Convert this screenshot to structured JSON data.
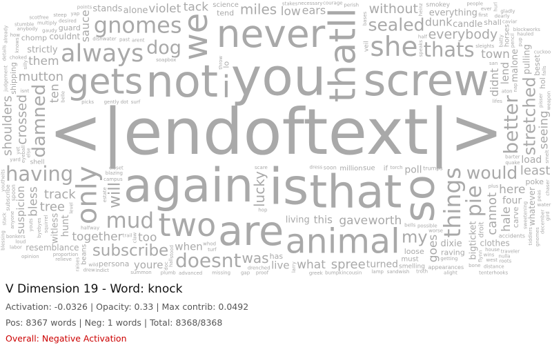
{
  "title": "V Dimension 19 - Word: knock",
  "stats_line": "Activation: -0.0326 | Opacity: 0.33 | Max contrib: 0.0492",
  "counts_line": "Pos: 8367 words | Neg: 1 words | Total: 8368/8368",
  "status": {
    "text": "Overall: Negative Activation",
    "color": "#cc0000"
  },
  "word_cloud": {
    "text_color": "#a9a9a9",
    "words": [
      {
        "text": "<|endoftext|>",
        "weight": 100
      },
      {
        "text": "you",
        "weight": 82
      },
      {
        "text": "is",
        "weight": 78
      },
      {
        "text": "again",
        "weight": 74
      },
      {
        "text": "that",
        "weight": 72
      },
      {
        "text": "not",
        "weight": 70
      },
      {
        "text": "screw",
        "weight": 68
      },
      {
        "text": "so",
        "weight": 66
      },
      {
        "text": "are",
        "weight": 64
      },
      {
        "text": "never",
        "weight": 60
      },
      {
        "text": "thatll",
        "weight": 58
      },
      {
        "text": "gets",
        "weight": 55
      },
      {
        "text": "animal",
        "weight": 53
      },
      {
        "text": "we",
        "weight": 52
      },
      {
        "text": "two",
        "weight": 50
      },
      {
        "text": "i",
        "weight": 48
      },
      {
        "text": "only",
        "weight": 44
      },
      {
        "text": "she",
        "weight": 42
      },
      {
        "text": "always",
        "weight": 38
      },
      {
        "text": "things",
        "weight": 36
      },
      {
        "text": "gnomes",
        "weight": 35
      },
      {
        "text": "mud",
        "weight": 34
      },
      {
        "text": "pie",
        "weight": 33
      },
      {
        "text": "thats",
        "weight": 32
      },
      {
        "text": "having",
        "weight": 31
      },
      {
        "text": "better",
        "weight": 30
      },
      {
        "text": "doesnt",
        "weight": 30
      },
      {
        "text": "dog",
        "weight": 29
      },
      {
        "text": "damned",
        "weight": 28
      },
      {
        "text": "would",
        "weight": 27
      },
      {
        "text": "sealed",
        "weight": 27
      },
      {
        "text": "stretched",
        "weight": 26
      },
      {
        "text": "my",
        "weight": 26
      },
      {
        "text": "subscribe",
        "weight": 25
      },
      {
        "text": "will",
        "weight": 25
      },
      {
        "text": "was",
        "weight": 22
      },
      {
        "text": "miles",
        "weight": 22
      },
      {
        "text": "lucky",
        "weight": 22
      },
      {
        "text": "everybody",
        "weight": 21
      },
      {
        "text": "without",
        "weight": 21
      },
      {
        "text": "crossed",
        "weight": 21
      },
      {
        "text": "track",
        "weight": 20
      },
      {
        "text": "mutton",
        "weight": 20
      },
      {
        "text": "shoulders",
        "weight": 20
      },
      {
        "text": "spree",
        "weight": 20
      },
      {
        "text": "tree",
        "weight": 20
      },
      {
        "text": "cannot",
        "weight": 20
      },
      {
        "text": "least",
        "weight": 20
      },
      {
        "text": "worth",
        "weight": 19
      },
      {
        "text": "goes",
        "weight": 19
      },
      {
        "text": "violet",
        "weight": 19
      },
      {
        "text": "low",
        "weight": 19
      },
      {
        "text": "seeing",
        "weight": 19
      },
      {
        "text": "together",
        "weight": 19
      },
      {
        "text": "too",
        "weight": 19
      },
      {
        "text": "ten",
        "weight": 18
      },
      {
        "text": "gave",
        "weight": 18
      },
      {
        "text": "what",
        "weight": 18
      },
      {
        "text": "hale",
        "weight": 18
      },
      {
        "text": "tack",
        "weight": 18
      },
      {
        "text": "here",
        "weight": 18
      },
      {
        "text": "bless",
        "weight": 18
      },
      {
        "text": "town",
        "weight": 18
      },
      {
        "text": "them",
        "weight": 18
      },
      {
        "text": "sauce",
        "weight": 17
      },
      {
        "text": "dunk",
        "weight": 17
      },
      {
        "text": "ears",
        "weight": 17
      },
      {
        "text": "didnt",
        "weight": 17
      },
      {
        "text": "this",
        "weight": 16
      },
      {
        "text": "when",
        "weight": 16
      },
      {
        "text": "suspicion",
        "weight": 16
      },
      {
        "text": "youre",
        "weight": 16
      },
      {
        "text": "live",
        "weight": 16
      },
      {
        "text": "lend",
        "weight": 16
      },
      {
        "text": "load",
        "weight": 15
      },
      {
        "text": "four",
        "weight": 15
      },
      {
        "text": "hunt",
        "weight": 15
      },
      {
        "text": "poll",
        "weight": 15
      },
      {
        "text": "turned",
        "weight": 15
      },
      {
        "text": "malone",
        "weight": 14
      },
      {
        "text": "strictly",
        "weight": 14
      },
      {
        "text": "everything",
        "weight": 14
      },
      {
        "text": "bigticket",
        "weight": 14
      },
      {
        "text": "living",
        "weight": 14
      },
      {
        "text": "dixie",
        "weight": 14
      },
      {
        "text": "witless",
        "weight": 14
      },
      {
        "text": "alone",
        "weight": 14
      },
      {
        "text": "candle",
        "weight": 14
      },
      {
        "text": "pulling",
        "weight": 14
      },
      {
        "text": "stands",
        "weight": 14
      },
      {
        "text": "clothes",
        "weight": 13
      },
      {
        "text": "whatever",
        "weight": 13
      },
      {
        "text": "resemblance",
        "weight": 13
      },
      {
        "text": "couldnt",
        "weight": 13
      },
      {
        "text": "shipping",
        "weight": 12
      },
      {
        "text": "persona",
        "weight": 12
      },
      {
        "text": "loose",
        "weight": 12
      },
      {
        "text": "beset",
        "weight": 12
      },
      {
        "text": "raving",
        "weight": 12
      },
      {
        "text": "chomp",
        "weight": 12
      },
      {
        "text": "carve",
        "weight": 12
      },
      {
        "text": "tend",
        "weight": 12
      },
      {
        "text": "poke",
        "weight": 12
      },
      {
        "text": "lo",
        "weight": 12
      },
      {
        "text": "has",
        "weight": 12
      },
      {
        "text": "guard",
        "weight": 12
      },
      {
        "text": "hol",
        "weight": 12
      },
      {
        "text": "shall",
        "weight": 12
      },
      {
        "text": "must",
        "weight": 11
      },
      {
        "text": "droit",
        "weight": 11
      },
      {
        "text": "sue",
        "weight": 11
      },
      {
        "text": "if",
        "weight": 11
      },
      {
        "text": "beans",
        "weight": 11
      },
      {
        "text": "science",
        "weight": 11
      },
      {
        "text": "million",
        "weight": 11
      },
      {
        "text": "horses",
        "weight": 11
      },
      {
        "text": "smokey",
        "weight": 10
      },
      {
        "text": "shell",
        "weight": 10
      },
      {
        "text": "veil",
        "weight": 10
      },
      {
        "text": "smelling",
        "weight": 10
      },
      {
        "text": "appearances",
        "weight": 9
      },
      {
        "text": "spoon",
        "weight": 9
      },
      {
        "text": "trumps",
        "weight": 9
      },
      {
        "text": "soon",
        "weight": 9
      },
      {
        "text": "subscribe",
        "weight": 9
      },
      {
        "text": "accidents",
        "weight": 9
      },
      {
        "text": "campus",
        "weight": 8
      },
      {
        "text": "estate",
        "weight": 8
      },
      {
        "text": "drenched",
        "weight": 8
      },
      {
        "text": "blazing",
        "weight": 8
      },
      {
        "text": "belle",
        "weight": 8
      },
      {
        "text": "closet",
        "weight": 8
      },
      {
        "text": "soapbox",
        "weight": 8
      },
      {
        "text": "eyeball",
        "weight": 8
      },
      {
        "text": "dress",
        "weight": 8
      },
      {
        "text": "surf",
        "weight": 8
      },
      {
        "text": "bases",
        "weight": 8
      },
      {
        "text": "bells",
        "weight": 8
      },
      {
        "text": "possible",
        "weight": 8
      },
      {
        "text": "judgement",
        "weight": 8
      },
      {
        "text": "halfway",
        "weight": 8
      },
      {
        "text": "bumpkincousin",
        "weight": 8
      },
      {
        "text": "sweetening",
        "weight": 8
      },
      {
        "text": "barter",
        "weight": 8
      },
      {
        "text": "stakes",
        "weight": 8
      },
      {
        "text": "throw",
        "weight": 8
      },
      {
        "text": "scare",
        "weight": 8
      },
      {
        "text": "plumb",
        "weight": 8
      },
      {
        "text": "claw",
        "weight": 8
      },
      {
        "text": "getting",
        "weight": 8
      },
      {
        "text": "quake",
        "weight": 8
      },
      {
        "text": "larry",
        "weight": 8
      },
      {
        "text": "torch",
        "weight": 8
      },
      {
        "text": "picks",
        "weight": 8
      },
      {
        "text": "pisser",
        "weight": 8
      },
      {
        "text": "missing",
        "weight": 8
      },
      {
        "text": "necessary",
        "weight": 8
      },
      {
        "text": "december",
        "weight": 8
      },
      {
        "text": "desired",
        "weight": 8
      },
      {
        "text": "multiply",
        "weight": 8
      },
      {
        "text": "weapon",
        "weight": 8
      },
      {
        "text": "choked",
        "weight": 8
      },
      {
        "text": "lifes",
        "weight": 8
      },
      {
        "text": "smelt",
        "weight": 8
      },
      {
        "text": "arent",
        "weight": 8
      },
      {
        "text": "past",
        "weight": 8
      },
      {
        "text": "speaks",
        "weight": 8
      },
      {
        "text": "dishwater",
        "weight": 8
      },
      {
        "text": "proportion",
        "weight": 8
      },
      {
        "text": "stood",
        "weight": 8
      },
      {
        "text": "courage",
        "weight": 8
      },
      {
        "text": "half",
        "weight": 8
      },
      {
        "text": "else",
        "weight": 8
      },
      {
        "text": "plus",
        "weight": 8
      },
      {
        "text": "proof",
        "weight": 8
      },
      {
        "text": "squirrel",
        "weight": 8
      },
      {
        "text": "whod",
        "weight": 8
      },
      {
        "text": "yard",
        "weight": 8
      },
      {
        "text": "knows",
        "weight": 8
      },
      {
        "text": "sleights",
        "weight": 8
      },
      {
        "text": "perish",
        "weight": 8
      },
      {
        "text": "byebyes",
        "weight": 8
      },
      {
        "text": "hop",
        "weight": 8
      },
      {
        "text": "gap",
        "weight": 8
      },
      {
        "text": "heinz",
        "weight": 8
      },
      {
        "text": "gently",
        "weight": 8
      },
      {
        "text": "first",
        "weight": 8
      },
      {
        "text": "falls",
        "weight": 8
      },
      {
        "text": "worse",
        "weight": 8
      },
      {
        "text": "gaudy",
        "weight": 8
      },
      {
        "text": "flynn",
        "weight": 8
      },
      {
        "text": "indict",
        "weight": 8
      },
      {
        "text": "greek",
        "weight": 8
      },
      {
        "text": "batty",
        "weight": 8
      },
      {
        "text": "wild",
        "weight": 8
      },
      {
        "text": "trail",
        "weight": 8
      },
      {
        "text": "level",
        "weight": 8
      },
      {
        "text": "anybody",
        "weight": 8
      },
      {
        "text": "isnt",
        "weight": 8
      },
      {
        "text": "chaser",
        "weight": 8
      },
      {
        "text": "dearly",
        "weight": 8
      },
      {
        "text": "bonkers",
        "weight": 8
      },
      {
        "text": "anyone",
        "weight": 8
      },
      {
        "text": "bone",
        "weight": 8
      },
      {
        "text": "caviar",
        "weight": 8
      },
      {
        "text": "peas",
        "weight": 8
      },
      {
        "text": "aton",
        "weight": 8
      },
      {
        "text": "summon",
        "weight": 8
      },
      {
        "text": "pup",
        "weight": 8
      },
      {
        "text": "yap",
        "weight": 8
      },
      {
        "text": "troth",
        "weight": 8
      },
      {
        "text": "nap",
        "weight": 8
      },
      {
        "text": "sandwish",
        "weight": 8
      },
      {
        "text": "hauled",
        "weight": 8
      },
      {
        "text": "details",
        "weight": 8
      },
      {
        "text": "blockworks",
        "weight": 8
      },
      {
        "text": "advanced",
        "weight": 8
      },
      {
        "text": "youtheits",
        "weight": 8
      },
      {
        "text": "points",
        "weight": 8
      },
      {
        "text": "water",
        "weight": 8
      },
      {
        "text": "hall",
        "weight": 8
      },
      {
        "text": "turf",
        "weight": 8
      },
      {
        "text": "dot",
        "weight": 8
      },
      {
        "text": "yet",
        "weight": 8
      },
      {
        "text": "house",
        "weight": 8
      },
      {
        "text": "cuckoo",
        "weight": 8
      },
      {
        "text": "doc",
        "weight": 8
      },
      {
        "text": "people",
        "weight": 8
      },
      {
        "text": "san",
        "weight": 8
      },
      {
        "text": "youts",
        "weight": 8
      },
      {
        "text": "traveler",
        "weight": 8
      },
      {
        "text": "wins",
        "weight": 8
      },
      {
        "text": "silly",
        "weight": 8
      },
      {
        "text": "ever",
        "weight": 8
      },
      {
        "text": "how",
        "weight": 8
      },
      {
        "text": "gird",
        "weight": 8
      },
      {
        "text": "nulla",
        "weight": 8
      },
      {
        "text": "opinion",
        "weight": 8
      },
      {
        "text": "already",
        "weight": 8
      },
      {
        "text": "west",
        "weight": 8
      },
      {
        "text": "loud",
        "weight": 8
      },
      {
        "text": "hurl",
        "weight": 8
      },
      {
        "text": "drew",
        "weight": 8
      },
      {
        "text": "roots",
        "weight": 8
      },
      {
        "text": "pencil",
        "weight": 8
      },
      {
        "text": "labor",
        "weight": 8
      },
      {
        "text": "stumble",
        "weight": 8
      },
      {
        "text": "raises",
        "weight": 8
      },
      {
        "text": "gladly",
        "weight": 8
      },
      {
        "text": "distance",
        "weight": 8
      },
      {
        "text": "stack",
        "weight": 8
      },
      {
        "text": "steep",
        "weight": 8
      },
      {
        "text": "scotfree",
        "weight": 8
      },
      {
        "text": "blessing",
        "weight": 8
      },
      {
        "text": "alight",
        "weight": 8
      },
      {
        "text": "relieve",
        "weight": 8
      },
      {
        "text": "tiddlers",
        "weight": 8
      },
      {
        "text": "lamp",
        "weight": 8
      },
      {
        "text": "tenterhooks",
        "weight": 8
      },
      {
        "text": "gnomes",
        "weight": 8
      }
    ]
  }
}
